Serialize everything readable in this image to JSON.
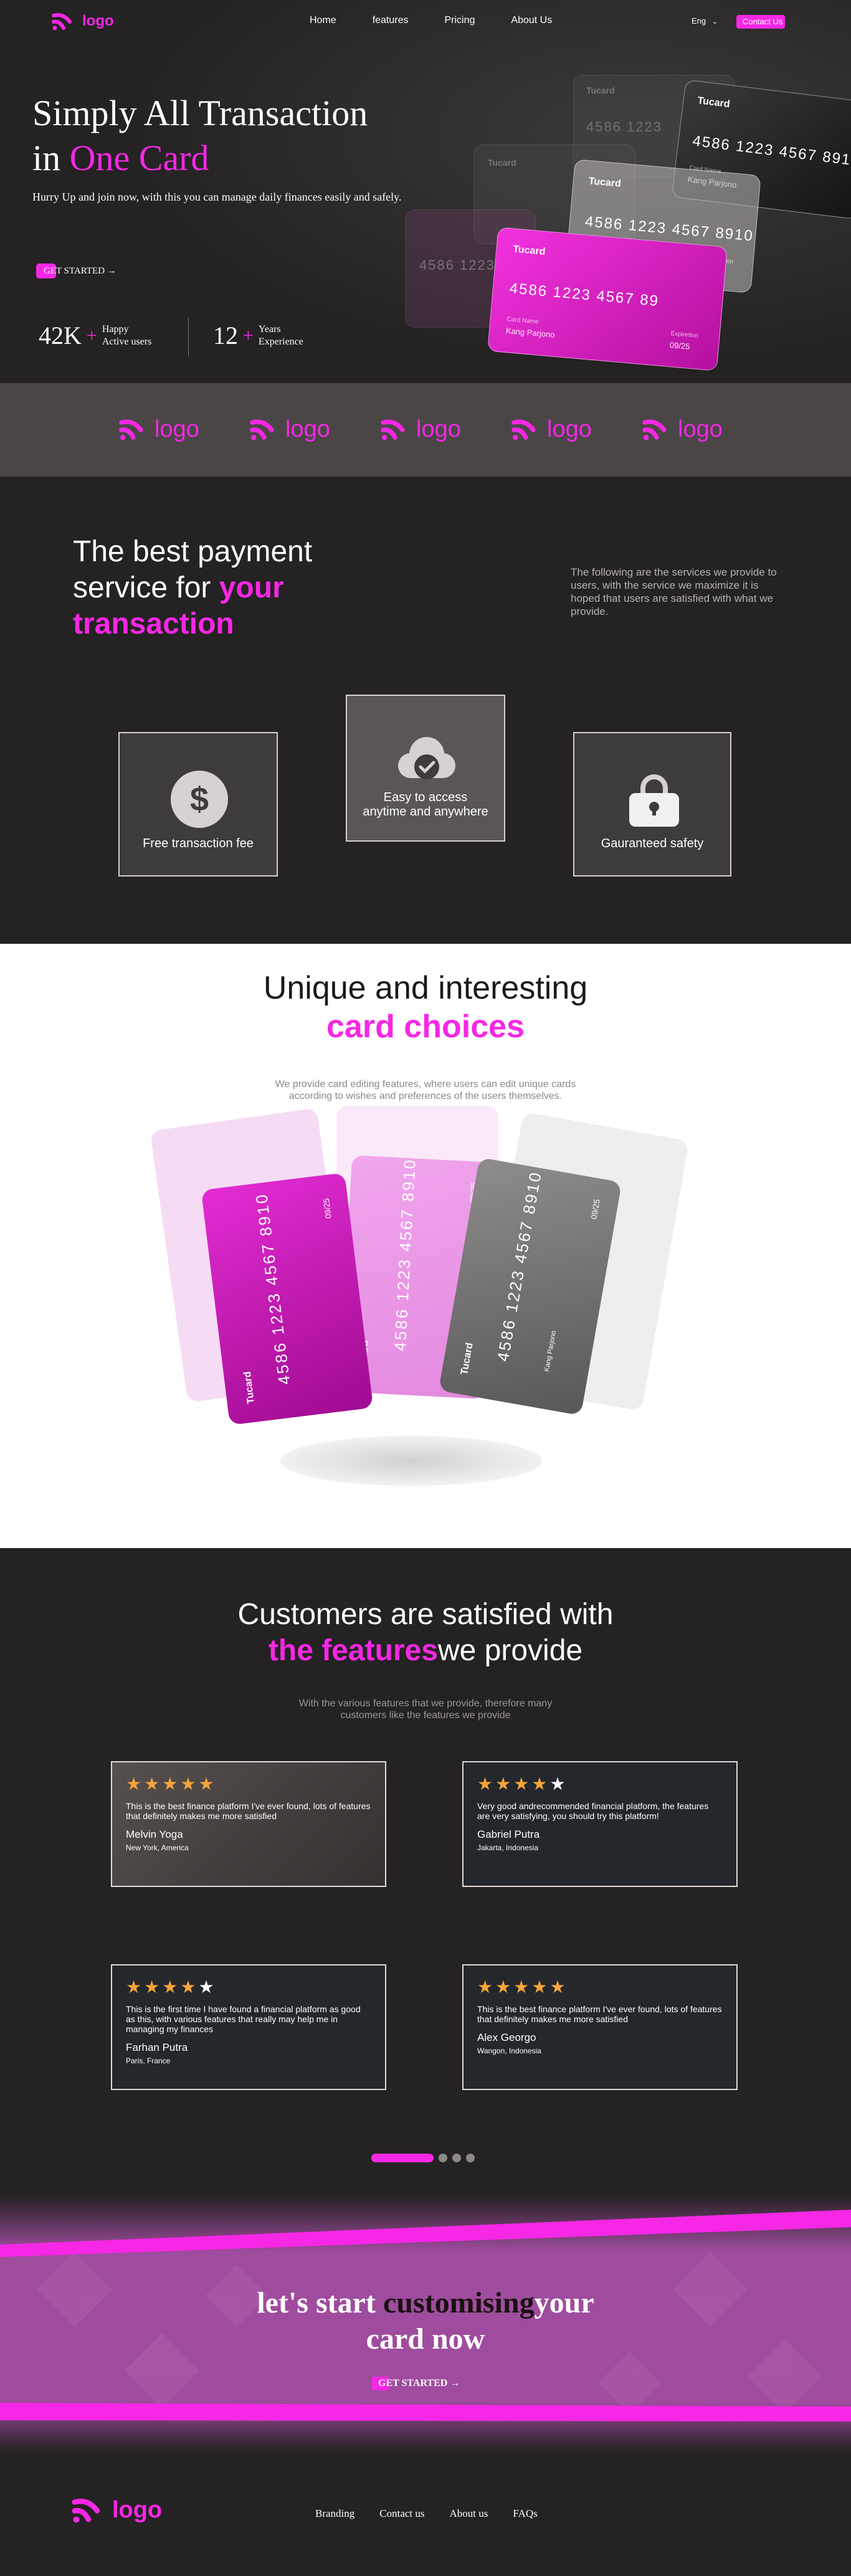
{
  "nav": {
    "logo": "logo",
    "links": [
      "Home",
      "features",
      "Pricing",
      "About Us"
    ],
    "lang": "Eng",
    "contact": "Contact Us"
  },
  "hero": {
    "title_line1": "Simply All Transaction",
    "title_line2_prefix": "in ",
    "title_line2_accent": "One Card",
    "subtitle": "Hurry Up and join now, with this you can manage daily finances easily and safely.",
    "cta": "GET STARTED →",
    "stats": [
      {
        "num": "42K",
        "plus": "+",
        "label1": "Happy",
        "label2": "Active users"
      },
      {
        "num": "12",
        "plus": "+",
        "label1": "Years",
        "label2": "Experience"
      }
    ]
  },
  "cards": {
    "brand": "Tucard",
    "number": "4586 1223 4567 8910",
    "number_short": "4586 1223 4567 891",
    "number_partial": "4586 1223 4567 89",
    "number_faint": "4586 1223",
    "holder_label": "Card Name",
    "holder": "Kang Parjono",
    "expiry_label": "Expiretion",
    "expiry": "09/25"
  },
  "strip": {
    "logos": [
      "logo",
      "logo",
      "logo",
      "logo",
      "logo"
    ]
  },
  "services": {
    "title_line1": "The best payment",
    "title_line2_prefix": "service for ",
    "title_line2_accent": "your",
    "title_line3_accent": "transaction",
    "description": "The following are the services we provide to users, with the service we maximize it is hoped that users are satisfied with what we provide.",
    "items": [
      {
        "label": "Free transaction fee",
        "icon": "dollar-icon"
      },
      {
        "label1": "Easy to access",
        "label2": "anytime and anywhere",
        "icon": "cloud-check-icon"
      },
      {
        "label": "Gauranteed safety",
        "icon": "lock-icon"
      }
    ]
  },
  "unique": {
    "title_line1": "Unique and interesting",
    "title_line2": "card choices",
    "description_line1": "We provide card editing features, where users can edit unique cards",
    "description_line2": "according to wishes and preferences of the users themselves."
  },
  "testimonials": {
    "title_line1": "Customers are satisfied with",
    "title_line2_accent": "the features",
    "title_line2_rest": "we provide",
    "description_line1": "With the various features that we provide, therefore many",
    "description_line2": "customers like the features we provide",
    "reviews": [
      {
        "rating": 5,
        "text": "This is the best finance platform I've ever found, lots of features that definitely makes me more satisfied",
        "name": "Melvin Yoga",
        "location": "New York, America"
      },
      {
        "rating": 4,
        "text": "Very good andrecommended financial platform, the features are very satisfying, you should try this platform!",
        "name": "Gabriel Putra",
        "location": "Jakarta, Indonesia"
      },
      {
        "rating": 4,
        "text": "This is the first time I have found a financial platform as good as this, with various features that really may help me in managing my finances",
        "name": "Farhan Putra",
        "location": "Paris, France"
      },
      {
        "rating": 5,
        "text": "This is the best finance platform I've ever found, lots of features that definitely makes me more satisfied",
        "name": "Alex Georgo",
        "location": "Wangon, Indonesia"
      }
    ],
    "slider": {
      "active": 1,
      "total": 4
    }
  },
  "cta": {
    "title_part1": "let's start ",
    "title_part2": "customising",
    "title_part3": "your",
    "title_line2": "card now",
    "button": "GET STARTED →"
  },
  "footer": {
    "logo": "logo",
    "links": [
      "Branding",
      "Contact us",
      "About us",
      "FAQs"
    ]
  },
  "colors": {
    "accent": "#f627e5",
    "dark": "#242222",
    "star": "#f6a33a",
    "cta_bg": "#9f4c9e"
  }
}
